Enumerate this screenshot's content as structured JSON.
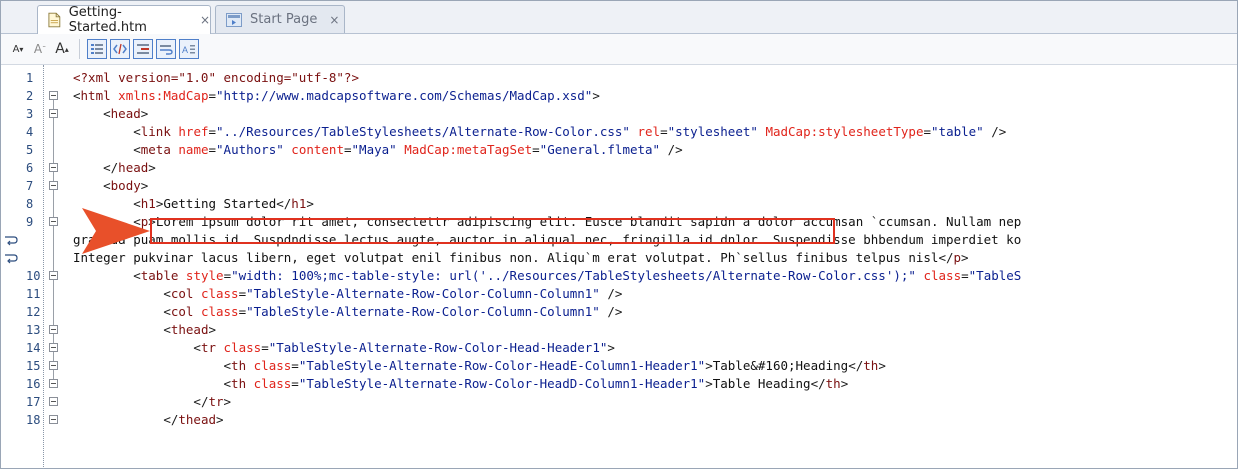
{
  "tabs": [
    {
      "label": "Getting-Started.htm",
      "close": "×",
      "active": true,
      "icon": "html-file-icon"
    },
    {
      "label": "Start Page",
      "close": "×",
      "active": false,
      "icon": "start-page-icon"
    }
  ],
  "toolbar": {
    "font_decrease": "A",
    "font_reset": "A",
    "font_increase": "A",
    "buttons": [
      "line-numbers-icon",
      "tag-view-icon",
      "indent-icon",
      "word-wrap-icon",
      "text-view-icon"
    ]
  },
  "editor": {
    "lines": [
      {
        "num": "1",
        "segs": [
          [
            "pi",
            "<?xml version=\"1.0\" encoding=\"utf-8\"?>"
          ]
        ]
      },
      {
        "num": "2",
        "segs": [
          [
            "br",
            "<"
          ],
          [
            "tag",
            "html"
          ],
          [
            "txt",
            " "
          ],
          [
            "attr",
            "xmlns:MadCap"
          ],
          [
            "br",
            "="
          ],
          [
            "val",
            "\"http://www.madcapsoftware.com/Schemas/MadCap.xsd\""
          ],
          [
            "br",
            ">"
          ]
        ]
      },
      {
        "num": "3",
        "segs": [
          [
            "txt",
            "    "
          ],
          [
            "br",
            "<"
          ],
          [
            "tag",
            "head"
          ],
          [
            "br",
            ">"
          ]
        ]
      },
      {
        "num": "4",
        "segs": [
          [
            "txt",
            "        "
          ],
          [
            "br",
            "<"
          ],
          [
            "tag",
            "link"
          ],
          [
            "txt",
            " "
          ],
          [
            "attr",
            "href"
          ],
          [
            "br",
            "="
          ],
          [
            "val",
            "\"../Resources/TableStylesheets/Alternate-Row-Color.css\""
          ],
          [
            "txt",
            " "
          ],
          [
            "attr",
            "rel"
          ],
          [
            "br",
            "="
          ],
          [
            "val",
            "\"stylesheet\""
          ],
          [
            "txt",
            " "
          ],
          [
            "attr",
            "MadCap:stylesheetType"
          ],
          [
            "br",
            "="
          ],
          [
            "val",
            "\"table\""
          ],
          [
            "br",
            " />"
          ]
        ]
      },
      {
        "num": "5",
        "segs": [
          [
            "txt",
            "        "
          ],
          [
            "br",
            "<"
          ],
          [
            "tag",
            "meta"
          ],
          [
            "txt",
            " "
          ],
          [
            "attr",
            "name"
          ],
          [
            "br",
            "="
          ],
          [
            "val",
            "\"Authors\""
          ],
          [
            "txt",
            " "
          ],
          [
            "attr",
            "content"
          ],
          [
            "br",
            "="
          ],
          [
            "val",
            "\"Maya\""
          ],
          [
            "txt",
            " "
          ],
          [
            "attr",
            "MadCap:metaTagSet"
          ],
          [
            "br",
            "="
          ],
          [
            "val",
            "\"General.flmeta\""
          ],
          [
            "br",
            " />"
          ]
        ]
      },
      {
        "num": "6",
        "segs": [
          [
            "txt",
            "    "
          ],
          [
            "br",
            "</"
          ],
          [
            "tag",
            "head"
          ],
          [
            "br",
            ">"
          ]
        ]
      },
      {
        "num": "7",
        "segs": [
          [
            "txt",
            "    "
          ],
          [
            "br",
            "<"
          ],
          [
            "tag",
            "body"
          ],
          [
            "br",
            ">"
          ]
        ]
      },
      {
        "num": "8",
        "segs": [
          [
            "txt",
            "        "
          ],
          [
            "br",
            "<"
          ],
          [
            "tag",
            "h1"
          ],
          [
            "br",
            ">"
          ],
          [
            "txt",
            "Getting Started"
          ],
          [
            "br",
            "</"
          ],
          [
            "tag",
            "h1"
          ],
          [
            "br",
            ">"
          ]
        ]
      },
      {
        "num": "9",
        "segs": [
          [
            "txt",
            "        "
          ],
          [
            "br",
            "<"
          ],
          [
            "tag",
            "p"
          ],
          [
            "br",
            ">"
          ],
          [
            "txt",
            "Lorem ipsum dolor rit amet, consectettr adipiscing elit. Eusce blandit sapidn a dolor accumsan `ccumsan. Nullam nep"
          ]
        ]
      },
      {
        "num": "",
        "segs": [
          [
            "txt",
            "gravida puam mollis id. Suspdndisse lectus augte, auctor in aliqual nec, fringilla id dnlor. Suspendisse bhbendum imperdiet ko"
          ]
        ]
      },
      {
        "num": "",
        "segs": [
          [
            "txt",
            "Integer pukvinar lacus libern, eget volutpat enil finibus non. Aliqu`m erat volutpat. Ph`sellus finibus telpus nisl"
          ],
          [
            "br",
            "</"
          ],
          [
            "tag",
            "p"
          ],
          [
            "br",
            ">"
          ]
        ]
      },
      {
        "num": "10",
        "segs": [
          [
            "txt",
            "        "
          ],
          [
            "br",
            "<"
          ],
          [
            "tag",
            "table"
          ],
          [
            "txt",
            " "
          ],
          [
            "attr",
            "style"
          ],
          [
            "br",
            "="
          ],
          [
            "val",
            "\"width: 100%;mc-table-style: url('../Resources/TableStylesheets/Alternate-Row-Color.css');\""
          ],
          [
            "txt",
            " "
          ],
          [
            "attr",
            "class"
          ],
          [
            "br",
            "="
          ],
          [
            "val",
            "\"TableS"
          ]
        ]
      },
      {
        "num": "11",
        "segs": [
          [
            "txt",
            "            "
          ],
          [
            "br",
            "<"
          ],
          [
            "tag",
            "col"
          ],
          [
            "txt",
            " "
          ],
          [
            "attr",
            "class"
          ],
          [
            "br",
            "="
          ],
          [
            "val",
            "\"TableStyle-Alternate-Row-Color-Column-Column1\""
          ],
          [
            "br",
            " />"
          ]
        ]
      },
      {
        "num": "12",
        "segs": [
          [
            "txt",
            "            "
          ],
          [
            "br",
            "<"
          ],
          [
            "tag",
            "col"
          ],
          [
            "txt",
            " "
          ],
          [
            "attr",
            "class"
          ],
          [
            "br",
            "="
          ],
          [
            "val",
            "\"TableStyle-Alternate-Row-Color-Column-Column1\""
          ],
          [
            "br",
            " />"
          ]
        ]
      },
      {
        "num": "13",
        "segs": [
          [
            "txt",
            "            "
          ],
          [
            "br",
            "<"
          ],
          [
            "tag",
            "thead"
          ],
          [
            "br",
            ">"
          ]
        ]
      },
      {
        "num": "14",
        "segs": [
          [
            "txt",
            "                "
          ],
          [
            "br",
            "<"
          ],
          [
            "tag",
            "tr"
          ],
          [
            "txt",
            " "
          ],
          [
            "attr",
            "class"
          ],
          [
            "br",
            "="
          ],
          [
            "val",
            "\"TableStyle-Alternate-Row-Color-Head-Header1\""
          ],
          [
            "br",
            ">"
          ]
        ]
      },
      {
        "num": "15",
        "segs": [
          [
            "txt",
            "                    "
          ],
          [
            "br",
            "<"
          ],
          [
            "tag",
            "th"
          ],
          [
            "txt",
            " "
          ],
          [
            "attr",
            "class"
          ],
          [
            "br",
            "="
          ],
          [
            "val",
            "\"TableStyle-Alternate-Row-Color-HeadE-Column1-Header1\""
          ],
          [
            "br",
            ">"
          ],
          [
            "txt",
            "Table&#160;Heading"
          ],
          [
            "br",
            "</"
          ],
          [
            "tag",
            "th"
          ],
          [
            "br",
            ">"
          ]
        ]
      },
      {
        "num": "16",
        "segs": [
          [
            "txt",
            "                    "
          ],
          [
            "br",
            "<"
          ],
          [
            "tag",
            "th"
          ],
          [
            "txt",
            " "
          ],
          [
            "attr",
            "class"
          ],
          [
            "br",
            "="
          ],
          [
            "val",
            "\"TableStyle-Alternate-Row-Color-HeadD-Column1-Header1\""
          ],
          [
            "br",
            ">"
          ],
          [
            "txt",
            "Table Heading"
          ],
          [
            "br",
            "</"
          ],
          [
            "tag",
            "th"
          ],
          [
            "br",
            ">"
          ]
        ]
      },
      {
        "num": "17",
        "segs": [
          [
            "txt",
            "                "
          ],
          [
            "br",
            "</"
          ],
          [
            "tag",
            "tr"
          ],
          [
            "br",
            ">"
          ]
        ]
      },
      {
        "num": "18",
        "segs": [
          [
            "txt",
            "            "
          ],
          [
            "br",
            "</"
          ],
          [
            "tag",
            "thead"
          ],
          [
            "br",
            ">"
          ]
        ]
      }
    ]
  },
  "colors": {
    "highlight": "#e0311f",
    "arrow": "#e8502a",
    "attr": "#e0241b",
    "value": "#0a1f8f",
    "tag": "#7a1010"
  }
}
